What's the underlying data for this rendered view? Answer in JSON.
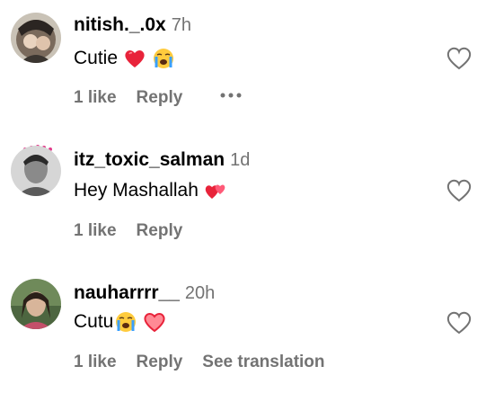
{
  "comments": [
    {
      "username": "nitish._.0x",
      "time": "7h",
      "text": "Cutie",
      "emojis": [
        "red-heart-emoji",
        "loudly-crying-face-emoji"
      ],
      "likes": "1 like",
      "reply": "Reply",
      "extra": ""
    },
    {
      "username": "itz_toxic_salman",
      "time": "1d",
      "text": "Hey Mashallah",
      "emojis": [
        "two-hearts-emoji"
      ],
      "likes": "1 like",
      "reply": "Reply",
      "extra": ""
    },
    {
      "username": "nauharrrr__",
      "time": "20h",
      "text": "Cutu",
      "emojis": [
        "loudly-crying-face-emoji",
        "heart-emoji"
      ],
      "likes": "1 like",
      "reply": "Reply",
      "extra": "See translation"
    }
  ],
  "colors": {
    "text": "#000000",
    "muted": "#737373",
    "heart": "#e8233a"
  }
}
